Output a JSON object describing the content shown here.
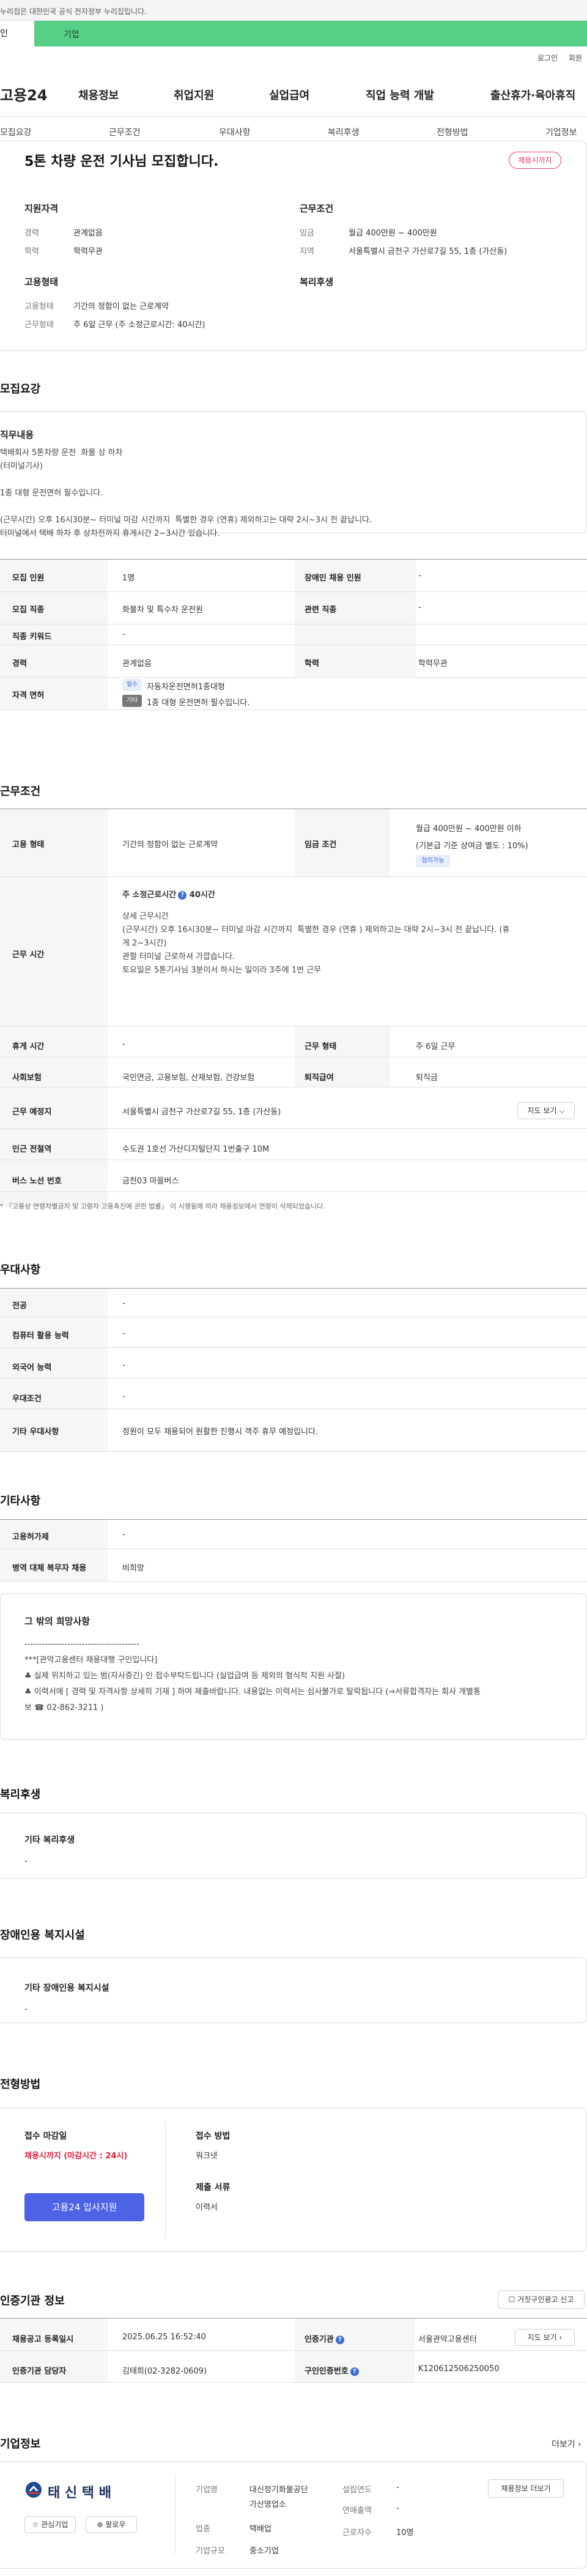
{
  "banner": "누리집은 대한민국 공식 전자정부 누리집입니다.",
  "top_tabs": {
    "personal": "인",
    "corporate": "기업"
  },
  "util": {
    "login": "로그인",
    "signup": "회원"
  },
  "brand": "고용24",
  "gnb": [
    "채용정보",
    "취업지원",
    "실업급여",
    "직업 능력 개발",
    "출산휴가·육아휴직"
  ],
  "anchors": [
    "모집요강",
    "근무조건",
    "우대사항",
    "복리후생",
    "전형방법",
    "기업정보"
  ],
  "job": {
    "title": "5톤 차량 운전 기사님 모집합니다.",
    "badge": "채용시까지",
    "qual": {
      "h": "지원자격",
      "exp_l": "경력",
      "exp_v": "관계없음",
      "edu_l": "학력",
      "edu_v": "학력무관"
    },
    "cond": {
      "h": "근무조건",
      "wage_l": "임금",
      "wage_v": "월급 400만원 ~ 400만원",
      "area_l": "지역",
      "area_v": "서울특별시 금천구 가산로7길 55, 1층 (가산동)"
    },
    "emp": {
      "h": "고용형태",
      "type_l": "고용형태",
      "type_v": "기간의 정함이 없는 근로계약",
      "sched_l": "근무형태",
      "sched_v": "주 6일 근무 (주 소정근로시간: 40시간)"
    },
    "welfare_h": "복리후생"
  },
  "recruit": {
    "h": "모집요강",
    "duty_h": "직무내용",
    "duty_text": "택배회사 5톤차량 운전  화물 상 하차\n(터미널기사)\n\n1종 대형 운전면허 필수입니다.\n\n(근무시간) 오후 16시30분~ 터미널 마감 시간까지  특별한 경우 (연휴) 제외하고는 대략 2시~3시 전 끝납니다.\n터미널에서 택배 하차 후 상차전까지 휴게시간 2~3시간 있습니다.",
    "rows": {
      "count_l": "모집 인원",
      "count_v": "1명",
      "disab_l": "장애인 채용 인원",
      "disab_v": "-",
      "job_l": "모집 직종",
      "job_v": "화물차 및 특수차 운전원",
      "rel_l": "관련 직종",
      "rel_v": "-",
      "kw_l": "직종 키워드",
      "kw_v": "-",
      "exp_l": "경력",
      "exp_v": "관계없음",
      "edu_l": "학력",
      "edu_v": "학력무관",
      "lic_l": "자격 면허",
      "lic_chip1": "필수",
      "lic_v1": "자동차운전면허1종대형",
      "lic_chip2": "기타",
      "lic_v2": "1종 대형 운전면허 필수입니다."
    }
  },
  "work": {
    "h": "근무조건",
    "type_l": "고용 형태",
    "type_v": "기간의 정함이 없는 근로계약",
    "wage_l": "임금 조건",
    "wage_v1": "월급 400만원 ~ 400만원 이하",
    "wage_v2": "(기본급 기준 상여금 별도 : 10%)",
    "wage_tag": "협의가능",
    "hours_l": "근무 시간",
    "hours_title": "주 소정근로시간",
    "hours_title2": "40시간",
    "hours_text": "상세 근무시간\n(근무시간) 오후 16시30분~ 터미널 마감 시간까지  특별한 경우 (연휴 ) 제외하고는 대략 2시~3시 전 끝납니다. (휴\n게 2~3시간)\n관할 터미널 근로하셔 가깝습니다.\n토요일은 5톤기사님 3분이서 하시는 일이라 3주에 1번 근무",
    "rest_l": "휴게 시간",
    "rest_v": "-",
    "form_l": "근무 형태",
    "form_v": "주 6일 근무",
    "ins_l": "사회보험",
    "ins_v": "국민연금, 고용보험, 산재보험, 건강보험",
    "ret_l": "퇴직급여",
    "ret_v": "퇴직금",
    "place_l": "근무 예정지",
    "place_v": "서울특별시 금천구 가산로7길 55, 1층 (가산동)",
    "map_btn": "지도 보기",
    "sub_l": "인근 전철역",
    "sub_v": "수도권 1호선 가산디지털단지 1번출구 10M",
    "bus_l": "버스 노선 번호",
    "bus_v": "금천03 마을버스",
    "note": "* 『고용상 연령차별금지 및 고령자 고용촉진에 관한 법률』 이 시행됨에 따라 채용정보에서 연령이 삭제되었습니다."
  },
  "pref": {
    "h": "우대사항",
    "rows": [
      {
        "l": "전공",
        "v": "-"
      },
      {
        "l": "컴퓨터 활용 능력",
        "v": "-"
      },
      {
        "l": "외국어 능력",
        "v": "-"
      },
      {
        "l": "우대조건",
        "v": "-"
      },
      {
        "l": "기타 우대사항",
        "v": "정원이 모두 채용되어 원활한 진행시 객주 휴무 예정입니다."
      }
    ]
  },
  "etc": {
    "h": "기타사항",
    "ins_l": "고용허가제",
    "ins_v": "-",
    "mil_l": "병역 대체 복무자 채용",
    "mil_v": "비희망",
    "box_h": "그 밖의 희망사항",
    "box_text": "----------------------------------------\n***[관악고용센터 채용대행 구인입니다]\n♣ 실제 위치하고 있는 범(자사증긴) 인 접수부탁드립니다 (실업급여 등 제외의 형식적 지원 사절)\n♣ 이력서에 [ 경력 및 자격사항 상세히 기재 ] 하여 제출바랍니다. 내용없는 이력서는 심사불가로 탈락됩니다 (⇒서류합격자는 회사 개별통\n보 ☎ 02-862-3211 )"
  },
  "welfare": {
    "h": "복리후생",
    "box_h": "기타 복리후생",
    "box_v": "-"
  },
  "disab": {
    "h": "장애인용 복지시설",
    "box_h": "기타 장애인용 복지시설",
    "box_v": "-"
  },
  "process": {
    "h": "전형방법",
    "deadline_h": "접수 마감일",
    "deadline_v": "채용시까지 (마감시간 : 24시)",
    "method_h": "접수 방법",
    "method_v": "워크넷",
    "docs_h": "제출 서류",
    "docs_v": "이력서",
    "apply": "고용24 입사지원"
  },
  "agency": {
    "h": "인증기관 정보",
    "report": "거짓구인광고 신고",
    "reg_l": "채용공고 등록일시",
    "reg_v": "2025.06.25 16:52:40",
    "agency_l": "인증기관",
    "agency_v": "서울관악고용센터",
    "map_btn": "지도 보기",
    "mgr_l": "인증기관 담당자",
    "mgr_v": "김태희(02-3282-0609)",
    "no_l": "구인인증번호",
    "no_v": "K120612506250050"
  },
  "company": {
    "h": "기업정보",
    "more": "더보기",
    "logo": "태 신 택 배",
    "fav": "관심기업",
    "follow": "팔로우",
    "name_l": "기업명",
    "name_v1": "대신정기화물공단",
    "name_v2": "가산영업소",
    "ind_l": "업종",
    "ind_v": "택배업",
    "size_l": "기업규모",
    "size_v": "중소기업",
    "year_l": "설립연도",
    "year_v": "-",
    "sales_l": "연매출액",
    "sales_v": "-",
    "emp_l": "근로자수",
    "emp_v": "10명",
    "jobs_btn": "채용정보 더보기"
  },
  "colors": {
    "tab_green": "#58cf86",
    "badge_pink": "#e83e6c",
    "apply_blue": "#4d63e6",
    "deadline_red": "#e2213f"
  }
}
